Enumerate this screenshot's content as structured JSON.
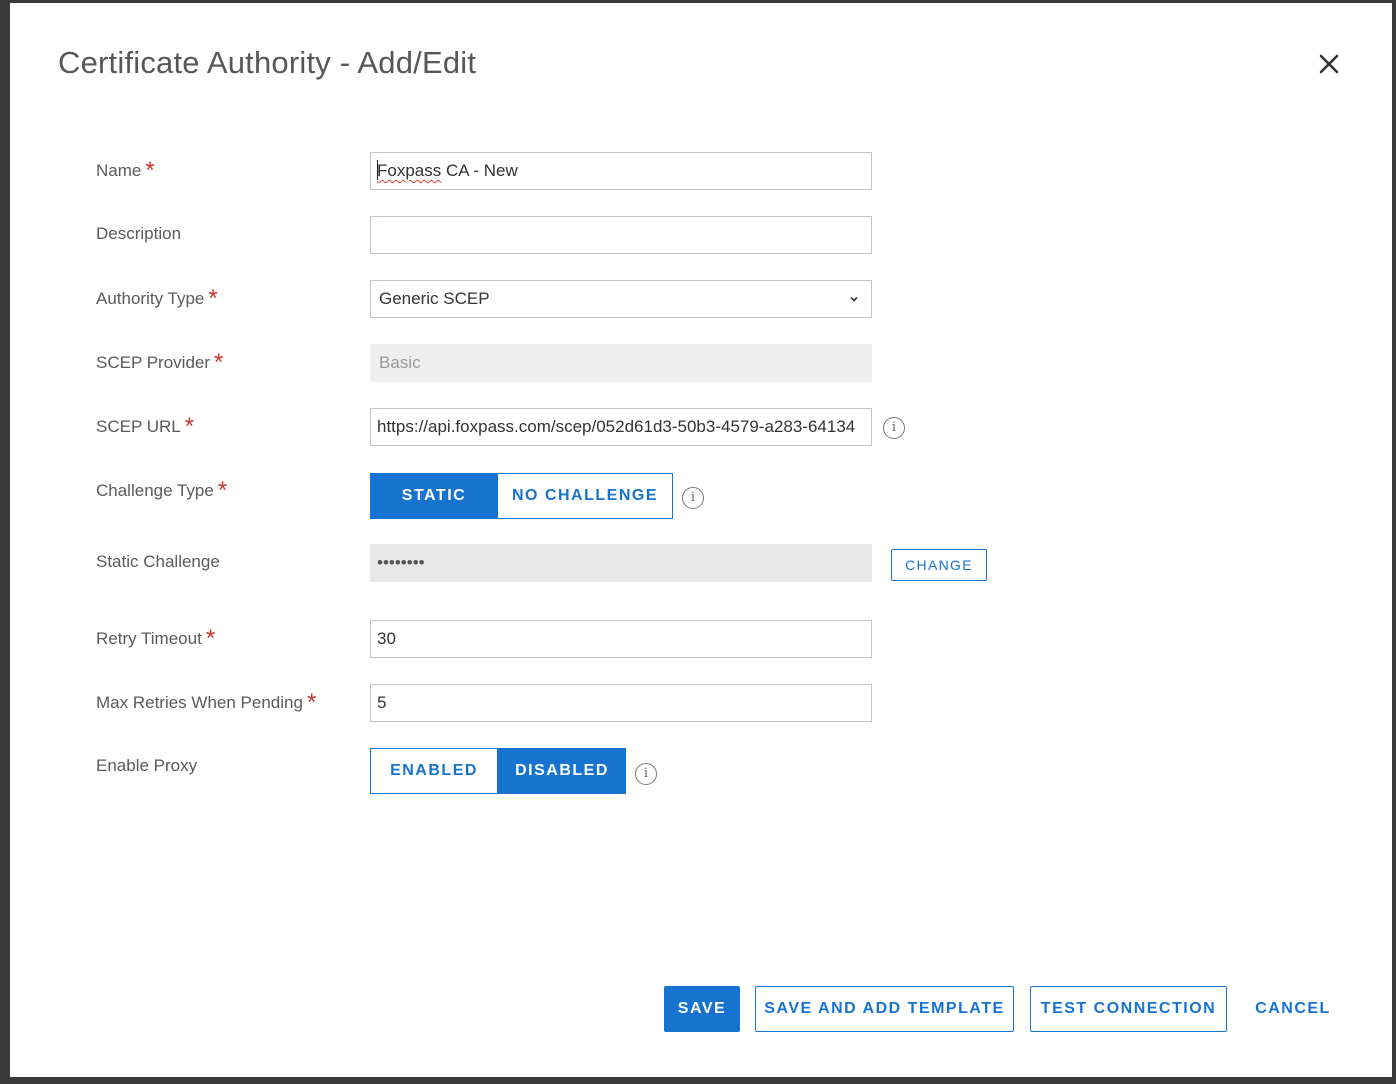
{
  "dialog": {
    "title": "Certificate Authority - Add/Edit",
    "close_icon": "close-icon"
  },
  "form": {
    "name": {
      "label": "Name",
      "value": "Foxpass CA - New",
      "required": true
    },
    "description": {
      "label": "Description",
      "value": "",
      "required": false
    },
    "authority_type": {
      "label": "Authority Type",
      "value": "Generic SCEP",
      "required": true
    },
    "scep_provider": {
      "label": "SCEP Provider",
      "value": "Basic",
      "required": true
    },
    "scep_url": {
      "label": "SCEP URL",
      "value": "https://api.foxpass.com/scep/052d61d3-50b3-4579-a283-64134",
      "required": true
    },
    "challenge_type": {
      "label": "Challenge Type",
      "options": [
        "STATIC",
        "NO CHALLENGE"
      ],
      "selected": "STATIC",
      "required": true
    },
    "static_challenge": {
      "label": "Static Challenge",
      "value": "••••••••",
      "change_label": "CHANGE"
    },
    "retry_timeout": {
      "label": "Retry Timeout",
      "value": "30",
      "required": true
    },
    "max_retries": {
      "label": "Max Retries When Pending",
      "value": "5",
      "required": true
    },
    "enable_proxy": {
      "label": "Enable Proxy",
      "options": [
        "ENABLED",
        "DISABLED"
      ],
      "selected": "DISABLED"
    },
    "required_marker": "*",
    "info_glyph": "i"
  },
  "footer": {
    "save": "SAVE",
    "save_and_add_template": "SAVE AND ADD TEMPLATE",
    "test_connection": "TEST CONNECTION",
    "cancel": "CANCEL"
  },
  "colors": {
    "accent": "#1773d0",
    "required": "#d0332b",
    "disabled_bg": "#efefef"
  }
}
